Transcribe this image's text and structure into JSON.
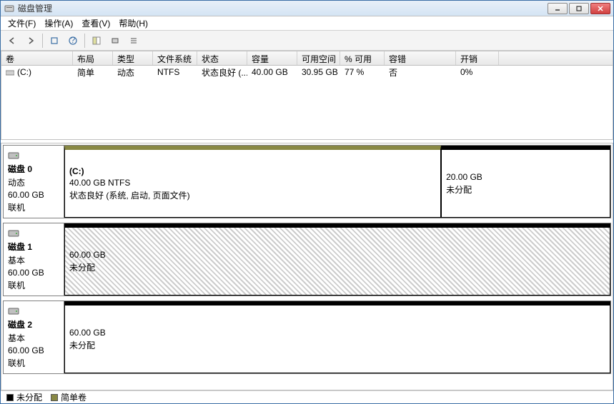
{
  "window": {
    "title": "磁盘管理"
  },
  "menu": {
    "file": "文件(F)",
    "action": "操作(A)",
    "view": "查看(V)",
    "help": "帮助(H)"
  },
  "columns": {
    "volume": "卷",
    "layout": "布局",
    "type": "类型",
    "fs": "文件系统",
    "status": "状态",
    "capacity": "容量",
    "free": "可用空间",
    "pct": "% 可用",
    "fault": "容错",
    "overhead": "开销"
  },
  "volumes": [
    {
      "name": "(C:)",
      "layout": "简单",
      "type": "动态",
      "fs": "NTFS",
      "status": "状态良好 (...",
      "capacity": "40.00 GB",
      "free": "30.95 GB",
      "pct": "77 %",
      "fault": "否",
      "overhead": "0%"
    }
  ],
  "disks": [
    {
      "name": "磁盘 0",
      "type": "动态",
      "size": "60.00 GB",
      "state": "联机",
      "parts": [
        {
          "label": "(C:)",
          "size": "40.00 GB NTFS",
          "status": "状态良好 (系统, 启动, 页面文件)",
          "kind": "simple",
          "grow": 2
        },
        {
          "label": "",
          "size": "20.00 GB",
          "status": "未分配",
          "kind": "unalloc",
          "grow": 1
        }
      ]
    },
    {
      "name": "磁盘 1",
      "type": "基本",
      "size": "60.00 GB",
      "state": "联机",
      "parts": [
        {
          "label": "",
          "size": "60.00 GB",
          "status": "未分配",
          "kind": "unalloc hatched",
          "grow": 1
        }
      ]
    },
    {
      "name": "磁盘 2",
      "type": "基本",
      "size": "60.00 GB",
      "state": "联机",
      "parts": [
        {
          "label": "",
          "size": "60.00 GB",
          "status": "未分配",
          "kind": "unalloc",
          "grow": 1
        }
      ]
    }
  ],
  "legend": {
    "unalloc": "未分配",
    "simple": "简单卷"
  }
}
